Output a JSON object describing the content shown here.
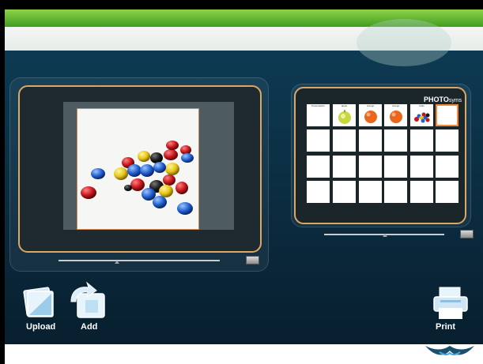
{
  "window": {
    "title": ""
  },
  "toolbar": {
    "upload_label": "Upload",
    "add_label": "Add",
    "print_label": "Print"
  },
  "symbol_grid": {
    "brand": "PHOTO",
    "brand_suffix": "syms",
    "cells": [
      {
        "label": "Presentation",
        "content": "blank"
      },
      {
        "label": "apple",
        "content": "apple"
      },
      {
        "label": "orange",
        "content": "orange"
      },
      {
        "label": "orange",
        "content": "orange"
      },
      {
        "label": "balls",
        "content": "balls"
      },
      {
        "label": "",
        "content": "selected-empty"
      }
    ]
  },
  "colors": {
    "green_bar": "#5cb82f",
    "panel_border": "#d9a865",
    "selected_border": "#f08a3a",
    "background": "#0d3a52"
  },
  "icons": [
    "upload-icon",
    "add-icon",
    "print-icon"
  ]
}
